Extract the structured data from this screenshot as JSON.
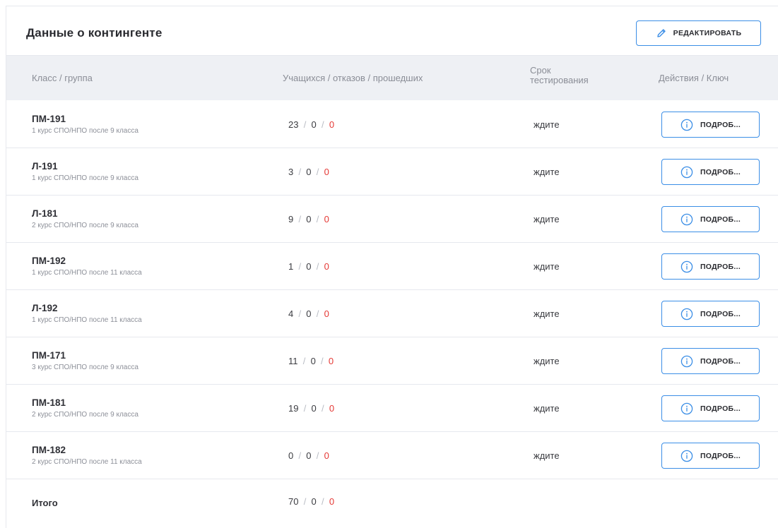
{
  "header": {
    "title": "Данные о контингенте",
    "edit_label": "РЕДАКТИРОВАТЬ",
    "edit_icon": "pencil-icon"
  },
  "columns": {
    "group": "Класс / группа",
    "students": "Учащихся / отказов / прошедших",
    "deadline_line1": "Срок",
    "deadline_line2": "тестирования",
    "actions": "Действия / Ключ"
  },
  "rows": [
    {
      "name": "ПМ-191",
      "desc": "1 курс СПО/НПО после 9 класса",
      "students": "23",
      "refused": "0",
      "passed": "0",
      "deadline": "ждите",
      "action": "ПОДРОБ..."
    },
    {
      "name": "Л-191",
      "desc": "1 курс СПО/НПО после 9 класса",
      "students": "3",
      "refused": "0",
      "passed": "0",
      "deadline": "ждите",
      "action": "ПОДРОБ..."
    },
    {
      "name": "Л-181",
      "desc": "2 курс СПО/НПО после 9 класса",
      "students": "9",
      "refused": "0",
      "passed": "0",
      "deadline": "ждите",
      "action": "ПОДРОБ..."
    },
    {
      "name": "ПМ-192",
      "desc": "1 курс СПО/НПО после 11 класса",
      "students": "1",
      "refused": "0",
      "passed": "0",
      "deadline": "ждите",
      "action": "ПОДРОБ..."
    },
    {
      "name": "Л-192",
      "desc": "1 курс СПО/НПО после 11 класса",
      "students": "4",
      "refused": "0",
      "passed": "0",
      "deadline": "ждите",
      "action": "ПОДРОБ..."
    },
    {
      "name": "ПМ-171",
      "desc": "3 курс СПО/НПО после 9 класса",
      "students": "11",
      "refused": "0",
      "passed": "0",
      "deadline": "ждите",
      "action": "ПОДРОБ..."
    },
    {
      "name": "ПМ-181",
      "desc": "2 курс СПО/НПО после 9 класса",
      "students": "19",
      "refused": "0",
      "passed": "0",
      "deadline": "ждите",
      "action": "ПОДРОБ..."
    },
    {
      "name": "ПМ-182",
      "desc": "2 курс СПО/НПО после 11 класса",
      "students": "0",
      "refused": "0",
      "passed": "0",
      "deadline": "ждите",
      "action": "ПОДРОБ..."
    }
  ],
  "total": {
    "label": "Итого",
    "students": "70",
    "refused": "0",
    "passed": "0"
  },
  "colors": {
    "accent": "#3b8ee6",
    "passed": "#e53935",
    "header_bg": "#eef0f4"
  },
  "icons": {
    "details": "info-circle-icon"
  }
}
